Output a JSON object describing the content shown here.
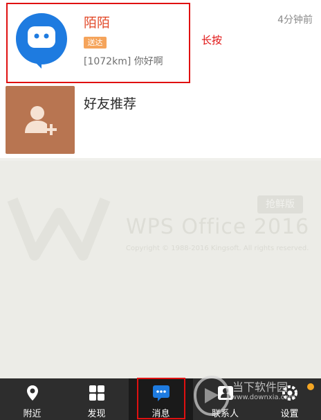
{
  "conversations": [
    {
      "name": "陌陌",
      "badge": "送达",
      "preview": "[1072km] 你好啊",
      "time": "4分钟前",
      "avatar_icon": "chat-bubble-icon",
      "avatar_color": "#1e7be0"
    },
    {
      "name": "好友推荐",
      "avatar_icon": "add-friend-icon",
      "avatar_color": "#b87551"
    }
  ],
  "annotation": {
    "label": "长按",
    "color": "#e01010"
  },
  "watermark": {
    "title": "WPS Office 2016",
    "badge": "抢鲜版",
    "copyright": "Copyright © 1988-2016 Kingsoft. All rights reserved."
  },
  "nav": {
    "items": [
      {
        "label": "附近",
        "icon": "location-pin-icon"
      },
      {
        "label": "发现",
        "icon": "grid-icon"
      },
      {
        "label": "消息",
        "icon": "message-icon",
        "active": true
      },
      {
        "label": "联系人",
        "icon": "contacts-icon"
      },
      {
        "label": "设置",
        "icon": "settings-icon"
      }
    ]
  },
  "site_watermark": {
    "text": "当下软件园",
    "url": "www.downxia.com"
  }
}
